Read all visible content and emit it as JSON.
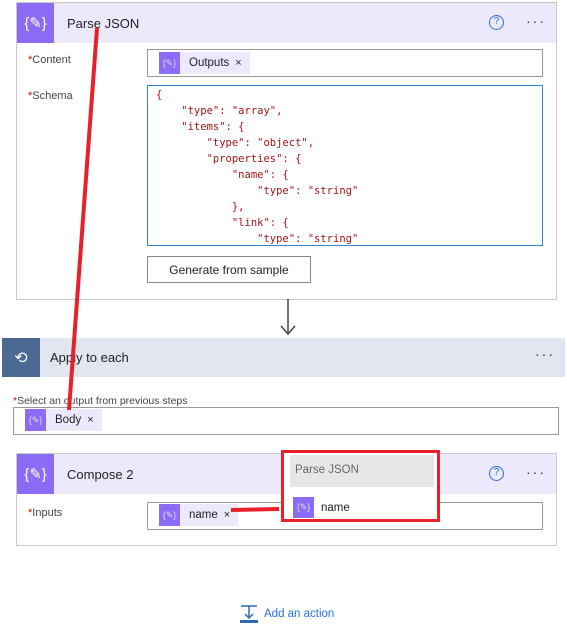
{
  "parse_json": {
    "title": "Parse JSON",
    "content_label": "Content",
    "content_token": "Outputs",
    "schema_label": "Schema",
    "schema_lines": [
      "{",
      "    \"type\": \"array\",",
      "    \"items\": {",
      "        \"type\": \"object\",",
      "        \"properties\": {",
      "            \"name\": {",
      "                \"type\": \"string\"",
      "            },",
      "            \"link\": {",
      "                \"type\": \"string\""
    ],
    "generate_button": "Generate from sample"
  },
  "apply_to_each": {
    "title": "Apply to each",
    "select_label": "Select an output from previous steps",
    "token": "Body"
  },
  "compose2": {
    "title": "Compose 2",
    "inputs_label": "Inputs",
    "token": "name"
  },
  "popup": {
    "header": "Parse JSON",
    "item": "name"
  },
  "add_action": "Add an action",
  "colors": {
    "accent": "#8c6cf7",
    "loop": "#4a6a94",
    "annotation": "#e8202a",
    "link": "#2870e0"
  }
}
